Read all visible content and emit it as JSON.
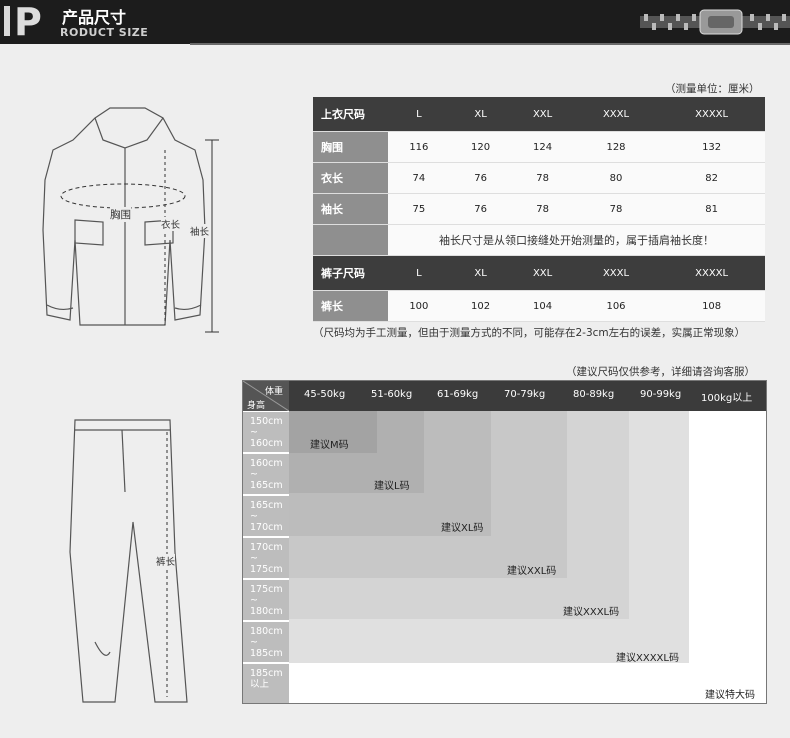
{
  "header": {
    "title": "产品尺寸",
    "subtitle": "RODUCT SIZE",
    "letter": "P"
  },
  "unit_note": "（测量单位：厘米）",
  "jacket_labels": {
    "chest": "胸围",
    "length": "衣长",
    "sleeve": "袖长"
  },
  "pants_labels": {
    "length": "裤长"
  },
  "top_table": {
    "top_header": {
      "label": "上衣尺码",
      "sizes": [
        "L",
        "XL",
        "XXL",
        "XXXL",
        "XXXXL"
      ]
    },
    "top_rows": [
      {
        "label": "胸围",
        "values": [
          "116",
          "120",
          "124",
          "128",
          "132"
        ]
      },
      {
        "label": "衣长",
        "values": [
          "74",
          "76",
          "78",
          "80",
          "82"
        ]
      },
      {
        "label": "袖长",
        "values": [
          "75",
          "76",
          "78",
          "78",
          "81"
        ]
      }
    ],
    "sleeve_note": "袖长尺寸是从领口接缝处开始测量的，属于插肩袖长度！",
    "pants_header": {
      "label": "裤子尺码",
      "sizes": [
        "L",
        "XL",
        "XXL",
        "XXXL",
        "XXXXL"
      ]
    },
    "pants_rows": [
      {
        "label": "裤长",
        "values": [
          "100",
          "102",
          "104",
          "106",
          "108"
        ]
      }
    ]
  },
  "measure_note": "（尺码均为手工测量，但由于测量方式的不同，可能存在2-3cm左右的误差，实属正常现象）",
  "suggest_note": "（建议尺码仅供参考，详细请咨询客服）",
  "grid": {
    "corner_top": "体重",
    "corner_bottom": "身高",
    "weights": [
      "45-50kg",
      "51-60kg",
      "61-69kg",
      "70-79kg",
      "80-89kg",
      "90-99kg",
      "100kg以上"
    ],
    "heights": [
      {
        "a": "150cm",
        "b": "~",
        "c": "160cm"
      },
      {
        "a": "160cm",
        "b": "~",
        "c": "165cm"
      },
      {
        "a": "165cm",
        "b": "~",
        "c": "170cm"
      },
      {
        "a": "170cm",
        "b": "~",
        "c": "175cm"
      },
      {
        "a": "175cm",
        "b": "~",
        "c": "180cm"
      },
      {
        "a": "180cm",
        "b": "~",
        "c": "185cm"
      },
      {
        "a": "185cm",
        "b": "以上",
        "c": ""
      }
    ],
    "recommendations": [
      "建议M码",
      "建议L码",
      "建议XL码",
      "建议XXL码",
      "建议XXXL码",
      "建议XXXXL码",
      "建议特大码"
    ],
    "colors": [
      "#a3a3a3",
      "#b0b0b0",
      "#bcbcbc",
      "#c8c8c8",
      "#d4d4d4",
      "#e0e0e0",
      "#ffffff"
    ]
  }
}
